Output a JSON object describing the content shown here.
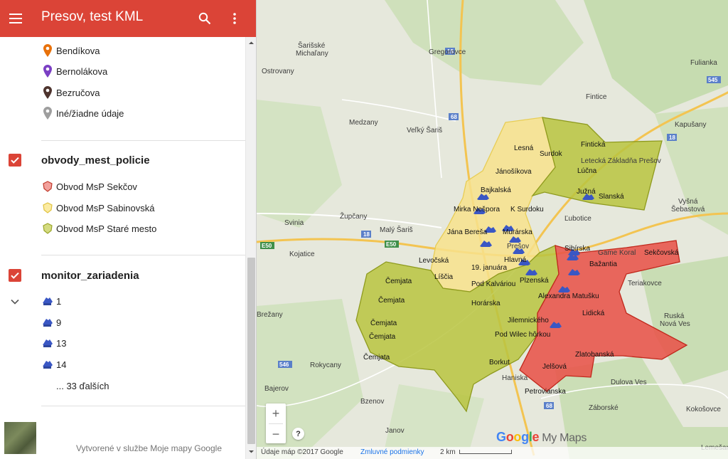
{
  "header": {
    "title": "Presov, test KML"
  },
  "styles_legend": [
    {
      "label": "Bendíkova",
      "color": "#e8710a"
    },
    {
      "label": "Bernolákova",
      "color": "#7b3fc4"
    },
    {
      "label": "Bezručova",
      "color": "#4e342e"
    },
    {
      "label": "Iné/žiadne údaje",
      "color": "#9e9e9e"
    }
  ],
  "layers": [
    {
      "title": "obvody_mest_policie",
      "checked": true,
      "items": [
        {
          "label": "Obvod MsP Sekčov",
          "color": "#e8534a"
        },
        {
          "label": "Obvod MsP Sabinovská",
          "color": "#f9e27a"
        },
        {
          "label": "Obvod MsP Staré mesto",
          "color": "#b7c340"
        }
      ]
    },
    {
      "title": "monitor_zariadenia",
      "checked": true,
      "items": [
        {
          "label": "1"
        },
        {
          "label": "9"
        },
        {
          "label": "13"
        },
        {
          "label": "14"
        }
      ],
      "more_label": "... 33 ďalších"
    }
  ],
  "footer": {
    "text": "Vytvorené v službe Moje mapy Google"
  },
  "map": {
    "zoom_in": "+",
    "zoom_out": "−",
    "help": "?",
    "logo_google": "Google",
    "logo_mymaps": "My Maps",
    "attribution": "Údaje máp ©2017 Google",
    "terms": "Zmluvné podmienky",
    "scale": "2 km",
    "colors": {
      "sekcov": "#e8534a",
      "sabinovska": "#f7e28c",
      "stare_mesto": "#b9c43f",
      "marker": "#3a57c4"
    },
    "place_labels": {
      "sarisske_michalany": "Šarišské\nMichaľany",
      "gregorovce": "Gregorovce",
      "ostrovany": "Ostrovany",
      "fulianka": "Fulianka",
      "fintice": "Fintice",
      "medzany": "Medzany",
      "velky_saris": "Veľký Šariš",
      "hlavna": "Hlavná",
      "kapusany": "Kapušany",
      "lesna": "Lesná",
      "surdok": "Surdok",
      "finticka": "Fintická",
      "letecka": "Letecká Základňa Prešov",
      "janosikova": "Jánošíkova",
      "lucna": "Lúčna",
      "juzna": "Južná",
      "slanska": "Slanská",
      "vysna_sebastova": "Vyšná\nŠebastová",
      "bajkalska": "Bajkalská",
      "zupcany": "Župčany",
      "mirka_nespora": "Mirka Nešpora",
      "k_surdoku": "K Surdoku",
      "lubotice": "Ľubotice",
      "svinia": "Svinia",
      "maly_saris": "Malý Šariš",
      "jana_beresa": "Jána Bereša",
      "murarska": "Murárska",
      "presov": "Prešov",
      "sibirska": "Sibírska",
      "game_koral": "Game Koral",
      "sekcovska": "Sekčovská",
      "kojatice": "Kojatice",
      "levocska": "Levočská",
      "hlavna2": "Hlavná",
      "bazantia": "Bažantia",
      "teriakovce": "Teriakovce",
      "cemjata1": "Čemjata",
      "liscia": "Líščia",
      "januara": "19. januára",
      "plzenska": "Plzenská",
      "pod_kalvariou": "Pod Kalváriou",
      "alexandra": "Alexandra Matušku",
      "cemjata2": "Čemjata",
      "horarska": "Horárska",
      "lidicka": "Lidická",
      "ruska_nova_ves": "Ruská\nNová Ves",
      "brezany": "Brežany",
      "jilemnickeho": "Jilemnického",
      "cemjata3": "Čemjata",
      "pod_wilec": "Pod Wilec hôrkou",
      "cemjata4": "Čemjata",
      "zlatobanska": "Zlatobanská",
      "rokycany": "Rokycany",
      "borkut": "Borkut",
      "jelsova": "Jelšová",
      "haniska": "Haniska",
      "dulova_ves": "Dulova Ves",
      "bajerov": "Bajerov",
      "petrovianska": "Petrovianska",
      "bzenov": "Bzenov",
      "zaborske": "Záborské",
      "kokosovce": "Kokošovce",
      "janov": "Janov",
      "lemesany": "Lemešany",
      "r18a": "18",
      "r68a": "68",
      "r545": "545",
      "r18b": "18",
      "r18c": "18",
      "e50a": "E50",
      "e50b": "E50",
      "r546": "546",
      "r68b": "68"
    }
  }
}
